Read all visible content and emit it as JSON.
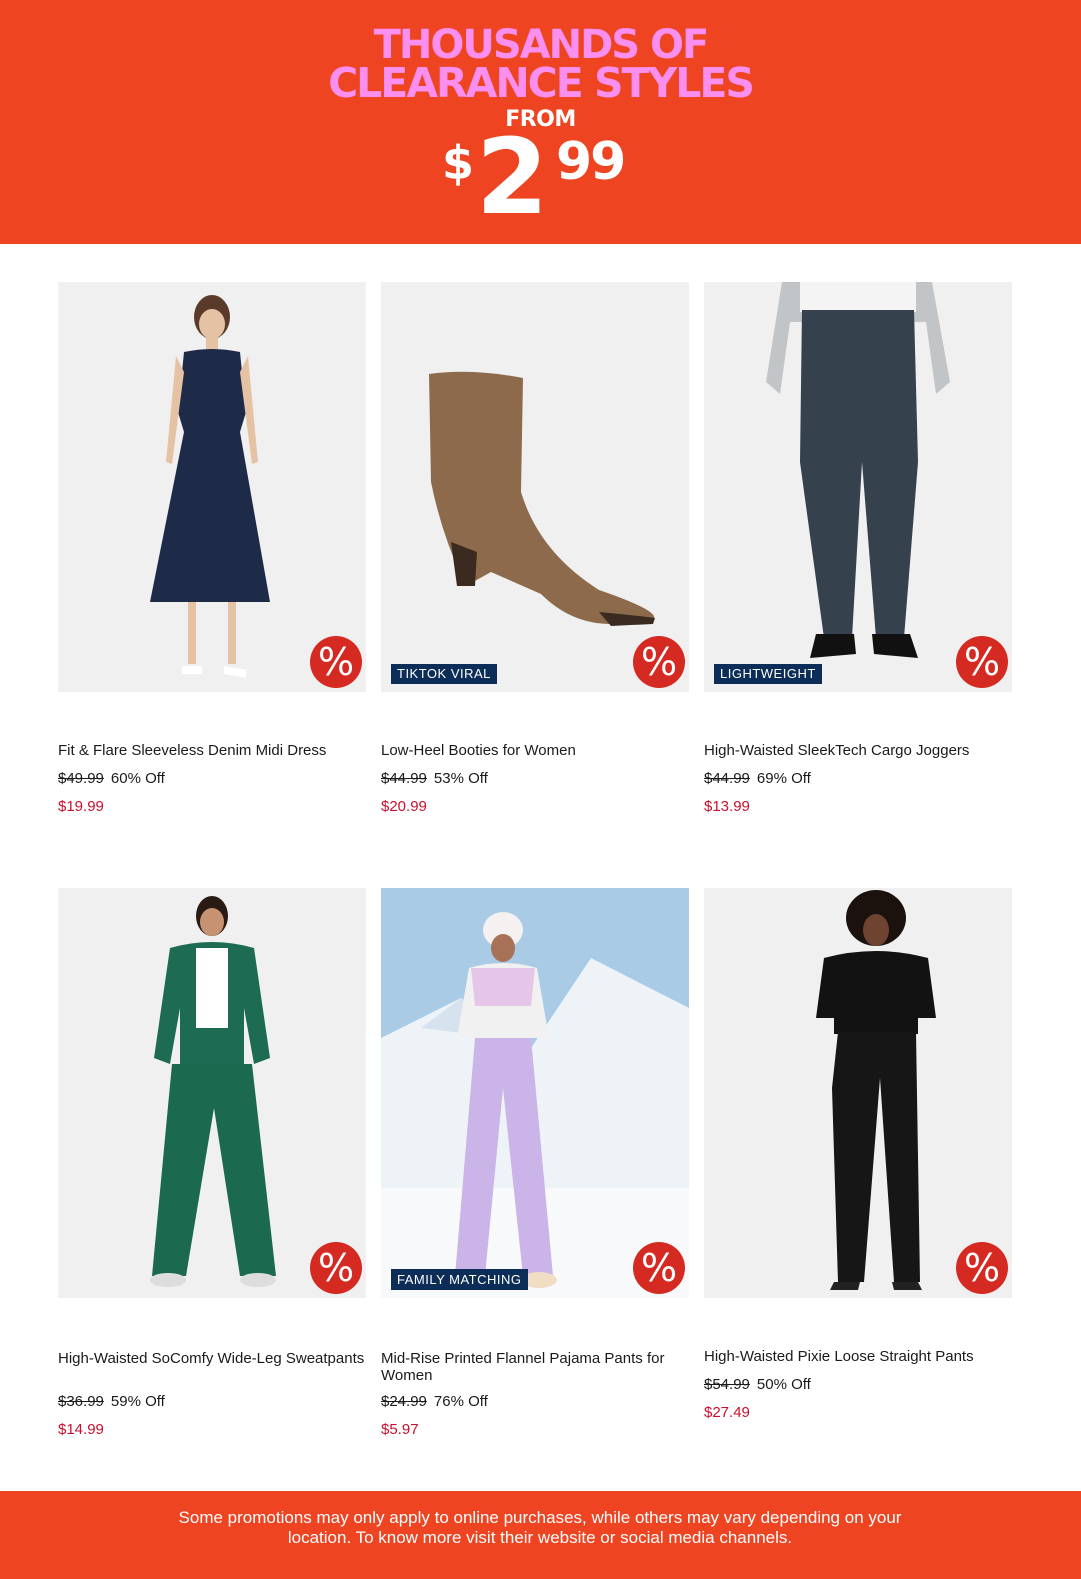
{
  "banner": {
    "line1": "THOUSANDS OF",
    "line2": "CLEARANCE STYLES",
    "from": "FROM",
    "price_currency": "$",
    "price_main": "2",
    "price_cents": "99",
    "bg_color": "#ee4421",
    "headline_color": "#fb8ff0"
  },
  "products": [
    {
      "name": "Fit & Flare Sleeveless Denim Midi Dress",
      "original_price": "$49.99",
      "discount": "60% Off",
      "sale_price": "$19.99",
      "tag": "",
      "badge_icon": "%"
    },
    {
      "name": "Low-Heel Booties for Women",
      "original_price": "$44.99",
      "discount": "53% Off",
      "sale_price": "$20.99",
      "tag": "TIKTOK VIRAL",
      "badge_icon": "%"
    },
    {
      "name": "High-Waisted SleekTech Cargo Joggers",
      "original_price": "$44.99",
      "discount": "69% Off",
      "sale_price": "$13.99",
      "tag": "LIGHTWEIGHT",
      "badge_icon": "%"
    },
    {
      "name": "High-Waisted SoComfy Wide-Leg Sweatpants",
      "original_price": "$36.99",
      "discount": "59% Off",
      "sale_price": "$14.99",
      "tag": "",
      "badge_icon": "%"
    },
    {
      "name": "Mid-Rise Printed Flannel Pajama Pants for Women",
      "original_price": "$24.99",
      "discount": "76% Off",
      "sale_price": "$5.97",
      "tag": "FAMILY MATCHING",
      "badge_icon": "%"
    },
    {
      "name": "High-Waisted Pixie Loose Straight Pants",
      "original_price": "$54.99",
      "discount": "50% Off",
      "sale_price": "$27.49",
      "tag": "",
      "badge_icon": "%"
    }
  ],
  "footer": {
    "text": "Some promotions may only apply to online purchases, while others may vary depending on your location. To know more visit their website or social media channels."
  },
  "colors": {
    "sale_red": "#c8102e",
    "badge_red": "#d42a21",
    "tag_navy": "#0c2d57"
  }
}
